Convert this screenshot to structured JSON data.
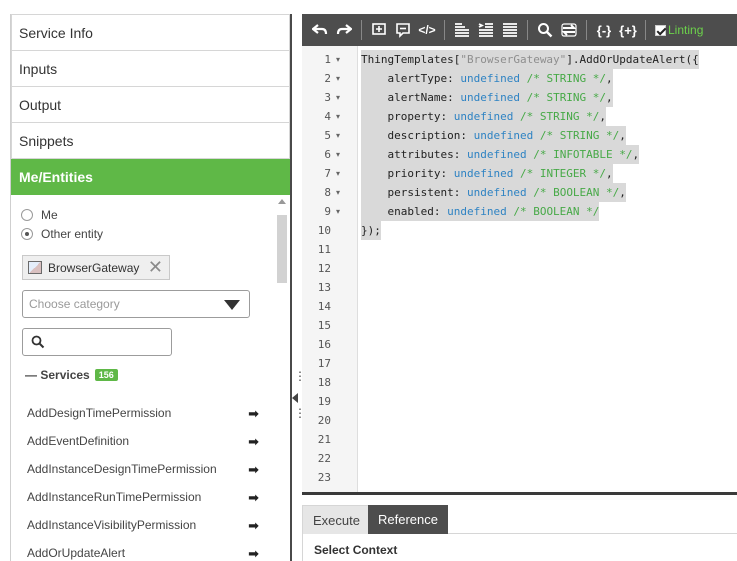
{
  "accordion": [
    "Service Info",
    "Inputs",
    "Output",
    "Snippets",
    "Me/Entities"
  ],
  "entities": {
    "radio_me": "Me",
    "radio_other": "Other entity",
    "selected_entity": "BrowserGateway",
    "category_placeholder": "Choose category",
    "services_label": "Services",
    "services_count": "156",
    "services": [
      "AddDesignTimePermission",
      "AddEventDefinition",
      "AddInstanceDesignTimePermission",
      "AddInstanceRunTimePermission",
      "AddInstanceVisibilityPermission",
      "AddOrUpdateAlert"
    ]
  },
  "toolbar": {
    "linting_label": "Linting",
    "icons": [
      "undo-icon",
      "redo-icon",
      "add-comment-icon",
      "comment-icon",
      "code-icon",
      "align-left-icon",
      "indent-icon",
      "justify-icon",
      "search-icon",
      "replace-icon",
      "fold-icon",
      "unfold-icon"
    ]
  },
  "code": {
    "line_numbers": [
      "1",
      "2",
      "3",
      "4",
      "5",
      "6",
      "7",
      "8",
      "9",
      "10",
      "11",
      "12",
      "13",
      "14",
      "15",
      "16",
      "17",
      "18",
      "19",
      "20",
      "21",
      "22",
      "23"
    ],
    "l1_a": "ThingTemplates[",
    "l1_str": "\"BrowserGateway\"",
    "l1_b": "].AddOrUpdateAlert({",
    "params": [
      {
        "name": "    alertType: ",
        "val": "undefined",
        "comment": " /* STRING */",
        "end": ","
      },
      {
        "name": "    alertName: ",
        "val": "undefined",
        "comment": " /* STRING */",
        "end": ","
      },
      {
        "name": "    property: ",
        "val": "undefined",
        "comment": " /* STRING */",
        "end": ","
      },
      {
        "name": "    description: ",
        "val": "undefined",
        "comment": " /* STRING */",
        "end": ","
      },
      {
        "name": "    attributes: ",
        "val": "undefined",
        "comment": " /* INFOTABLE */",
        "end": ","
      },
      {
        "name": "    priority: ",
        "val": "undefined",
        "comment": " /* INTEGER */",
        "end": ","
      },
      {
        "name": "    persistent: ",
        "val": "undefined",
        "comment": " /* BOOLEAN */",
        "end": ","
      },
      {
        "name": "    enabled: ",
        "val": "undefined",
        "comment": " /* BOOLEAN */",
        "end": ""
      }
    ],
    "l10": "});"
  },
  "tabs": {
    "execute": "Execute",
    "reference": "Reference"
  },
  "context_label": "Select Context",
  "colors": {
    "accent": "#5fb847",
    "toolbar": "#4d4d4d",
    "undefined": "#2f83c3",
    "comment": "#47a947"
  }
}
